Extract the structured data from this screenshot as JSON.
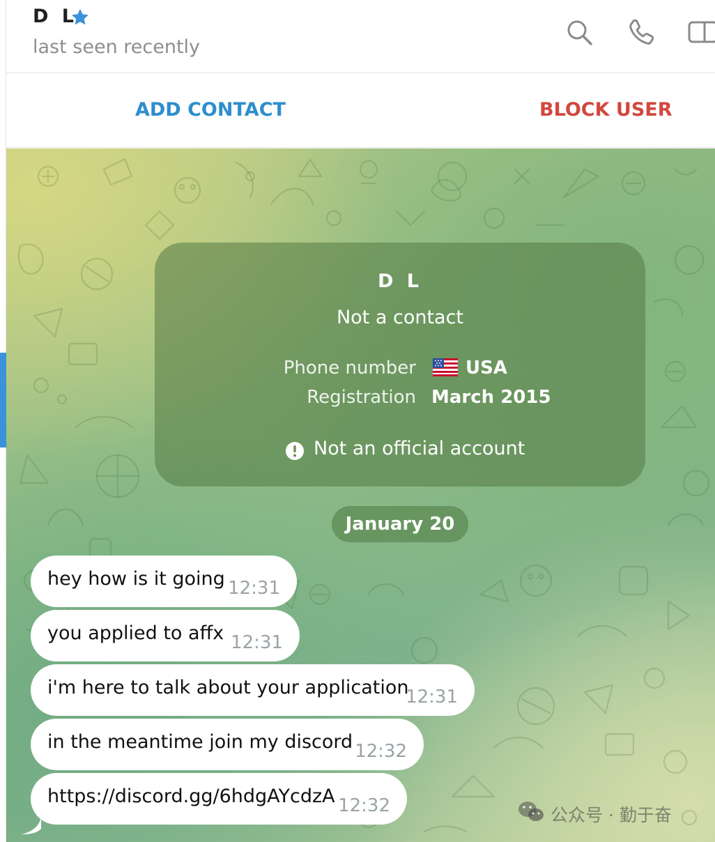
{
  "header": {
    "name": "D L",
    "status": "last seen recently",
    "icons": [
      "star-icon",
      "search-icon",
      "phone-icon",
      "sidebar-toggle-icon"
    ]
  },
  "actions": {
    "add_contact": "ADD CONTACT",
    "block_user": "BLOCK USER"
  },
  "info_card": {
    "name": "D L",
    "status": "Not a contact",
    "phone_label": "Phone number",
    "phone_value": "USA",
    "registration_label": "Registration",
    "registration_value": "March 2015",
    "note": "Not an official account"
  },
  "date_separator": "January 20",
  "messages": [
    {
      "text": "hey how is it going",
      "time": "12:31"
    },
    {
      "text": "you applied to affx",
      "time": "12:31"
    },
    {
      "text": "i'm here to talk about your application",
      "time": "12:31"
    },
    {
      "text": "in the meantime join my discord",
      "time": "12:32"
    },
    {
      "text": "https://discord.gg/6hdgAYcdzA",
      "time": "12:32"
    }
  ],
  "watermark": "公众号 · 勤于奋",
  "colors": {
    "accent_blue": "#2e8ecd",
    "danger_red": "#d2473f",
    "star_blue": "#3b92da"
  }
}
